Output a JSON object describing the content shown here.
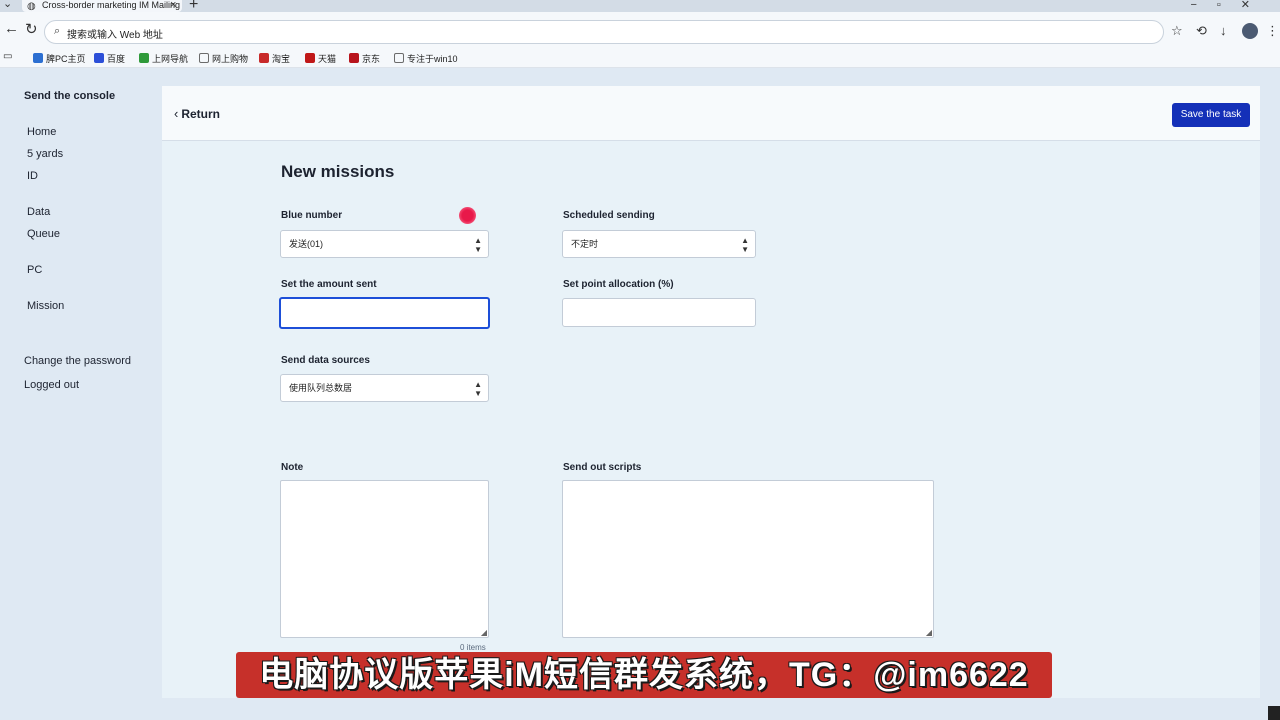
{
  "browser": {
    "tab_title": "Cross-border marketing IM Mailing",
    "address_text": "搜索或输入 Web 地址",
    "bookmarks": [
      {
        "label": "脾PC主页",
        "color": "#2c6fd1"
      },
      {
        "label": "百度",
        "color": "#2c4fd8"
      },
      {
        "label": "上网导航",
        "color": "#2f9a3a"
      },
      {
        "label": "网上购物",
        "color": "#6b6b6b"
      },
      {
        "label": "淘宝",
        "color": "#c82a2a"
      },
      {
        "label": "天猫",
        "color": "#c01818"
      },
      {
        "label": "京东",
        "color": "#b8141c"
      },
      {
        "label": "专注于win10",
        "color": "#6b6b6b"
      }
    ]
  },
  "sidebar": {
    "title": "Send the console",
    "items": [
      "Home",
      "5 yards",
      "ID",
      "Data",
      "Queue",
      "PC",
      "Mission"
    ],
    "bottom_items": [
      "Change the password",
      "Logged out"
    ]
  },
  "header": {
    "return_label": "Return",
    "save_label": "Save the task"
  },
  "form": {
    "title": "New missions",
    "blue_number": {
      "label": "Blue number",
      "value": "发送(01)"
    },
    "scheduled": {
      "label": "Scheduled sending",
      "value": "不定时"
    },
    "amount": {
      "label": "Set the amount sent",
      "value": ""
    },
    "point_allocation": {
      "label": "Set point allocation (%)",
      "value": ""
    },
    "data_source": {
      "label": "Send data sources",
      "value": "使用队列总数居"
    },
    "note": {
      "label": "Note",
      "counter": "0 items"
    },
    "scripts": {
      "label": "Send out scripts"
    }
  },
  "banner": {
    "text": "电脑协议版苹果iM短信群发系统，TG：@im6622"
  },
  "colors": {
    "accent": "#1430b8",
    "focus": "#1d4fd8",
    "banner": "#c6302a"
  }
}
